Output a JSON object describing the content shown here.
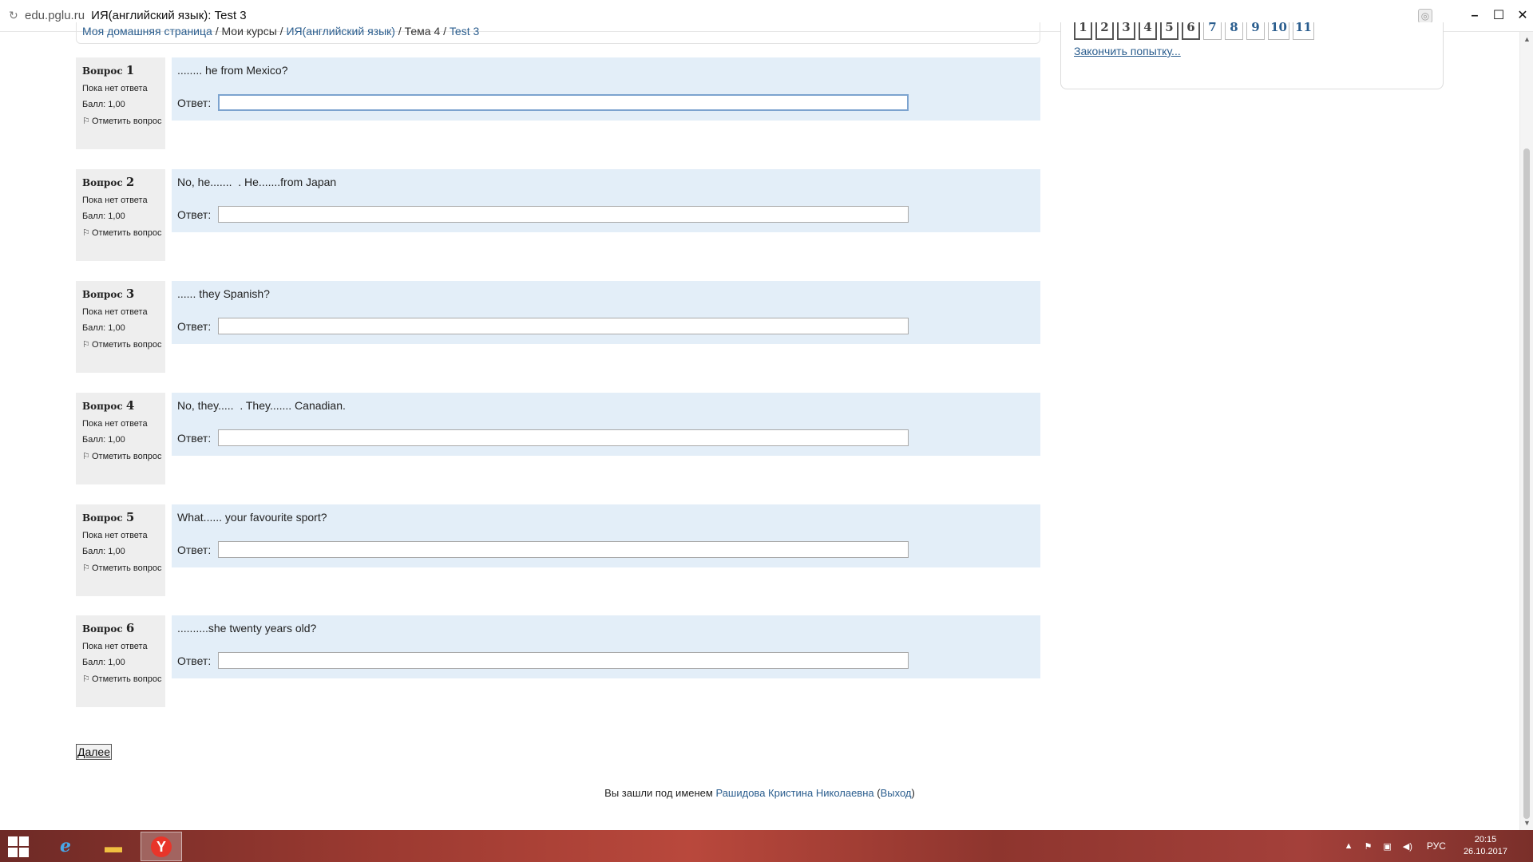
{
  "browser": {
    "domain": "edu.pglu.ru",
    "page_title": "ИЯ(английский язык): Test 3",
    "reload_icon": "reload-icon",
    "window_controls": {
      "minimize": "–",
      "maximize": "☐",
      "close": "✕"
    }
  },
  "breadcrumb": {
    "home": "Моя домашняя страница",
    "sep1": " / ",
    "my_courses": "Мои курсы",
    "sep2": " / ",
    "course": "ИЯ(английский язык)",
    "sep3": " / ",
    "section": "Тема 4",
    "sep4": " / ",
    "test": "Test 3"
  },
  "quiz_nav": {
    "buttons": [
      "1",
      "2",
      "3",
      "4",
      "5",
      "6",
      "7",
      "8",
      "9",
      "10",
      "11"
    ],
    "finish_label": "Закончить попытку..."
  },
  "questions": [
    {
      "number_label": "Вопрос",
      "number": "1",
      "state": "Пока нет ответа",
      "grade": "Балл: 1,00",
      "flag_label": "Отметить вопрос",
      "text": "........ he from Mexico?",
      "answer_label": "Ответ:",
      "answer_value": ""
    },
    {
      "number_label": "Вопрос",
      "number": "2",
      "state": "Пока нет ответа",
      "grade": "Балл: 1,00",
      "flag_label": "Отметить вопрос",
      "text": "No, he.......  . He.......from Japan",
      "answer_label": "Ответ:",
      "answer_value": ""
    },
    {
      "number_label": "Вопрос",
      "number": "3",
      "state": "Пока нет ответа",
      "grade": "Балл: 1,00",
      "flag_label": "Отметить вопрос",
      "text": "...... they Spanish?",
      "answer_label": "Ответ:",
      "answer_value": ""
    },
    {
      "number_label": "Вопрос",
      "number": "4",
      "state": "Пока нет ответа",
      "grade": "Балл: 1,00",
      "flag_label": "Отметить вопрос",
      "text": "No, they.....  . They....... Canadian.",
      "answer_label": "Ответ:",
      "answer_value": ""
    },
    {
      "number_label": "Вопрос",
      "number": "5",
      "state": "Пока нет ответа",
      "grade": "Балл: 1,00",
      "flag_label": "Отметить вопрос",
      "text": "What...... your favourite sport?",
      "answer_label": "Ответ:",
      "answer_value": ""
    },
    {
      "number_label": "Вопрос",
      "number": "6",
      "state": "Пока нет ответа",
      "grade": "Балл: 1,00",
      "flag_label": "Отметить вопрос",
      "text": "..........she twenty years old?",
      "answer_label": "Ответ:",
      "answer_value": ""
    }
  ],
  "next_button": "Далее",
  "login_info": {
    "prefix": "Вы зашли под именем ",
    "user": "Рашидова Кристина Николаевна",
    "open_paren": " (",
    "logout": "Выход",
    "close_paren": ")"
  },
  "taskbar": {
    "language": "РУС",
    "time": "20:15",
    "date": "26.10.2017"
  }
}
